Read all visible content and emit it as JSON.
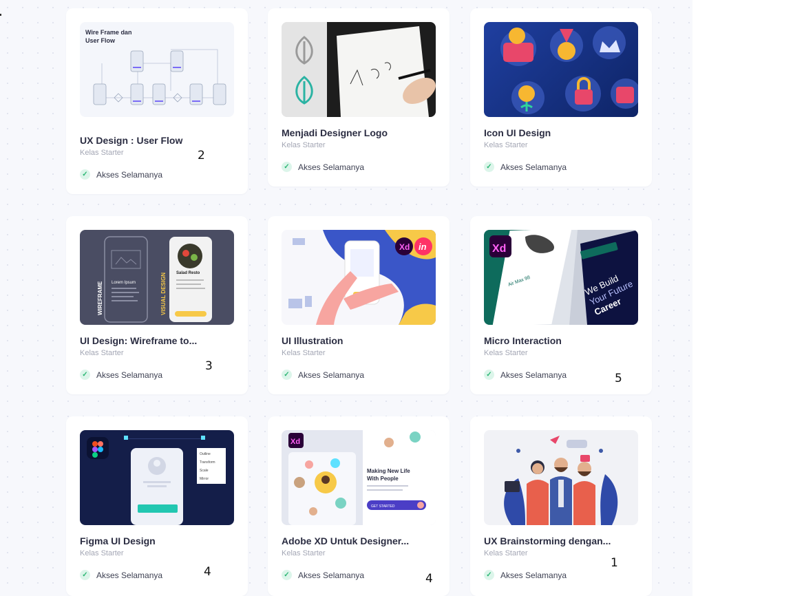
{
  "courses": [
    {
      "title": "UX Design : User Flow",
      "subtitle": "Kelas Starter",
      "access": "Akses Selamanya",
      "thumb_text": [
        "Wire Frame dan",
        "User Flow"
      ]
    },
    {
      "title": "Menjadi Designer Logo",
      "subtitle": "Kelas Starter",
      "access": "Akses Selamanya"
    },
    {
      "title": "Icon UI Design",
      "subtitle": "Kelas Starter",
      "access": "Akses Selamanya"
    },
    {
      "title": "UI Design: Wireframe to...",
      "subtitle": "Kelas Starter",
      "access": "Akses Selamanya",
      "thumb_text": [
        "WIREFRAME",
        "VISUAL DESIGN",
        "Lorem Ipsum",
        "Salad Resto"
      ]
    },
    {
      "title": "UI Illustration",
      "subtitle": "Kelas Starter",
      "access": "Akses Selamanya",
      "thumb_text": [
        "Xd",
        "in"
      ]
    },
    {
      "title": "Micro Interaction",
      "subtitle": "Kelas Starter",
      "access": "Akses Selamanya",
      "thumb_text": [
        "Xd",
        "We Build",
        "Your Future",
        "Career",
        "Air Max 98"
      ]
    },
    {
      "title": "Figma UI Design",
      "subtitle": "Kelas Starter",
      "access": "Akses Selamanya",
      "thumb_text": [
        "Outline",
        "Transform",
        "Scale",
        "Mirror"
      ]
    },
    {
      "title": "Adobe XD Untuk Designer...",
      "subtitle": "Kelas Starter",
      "access": "Akses Selamanya",
      "thumb_text": [
        "Xd",
        "Making New Life",
        "With People",
        "GET STARTED"
      ]
    },
    {
      "title": "UX Brainstorming dengan...",
      "subtitle": "Kelas Starter",
      "access": "Akses Selamanya"
    }
  ],
  "annotations": [
    "2",
    "3",
    "5",
    "4",
    "4",
    "1"
  ],
  "colors": {
    "title": "#2b2d42",
    "subtitle": "#a3a6b4",
    "check_bg": "#dcf5ea",
    "check": "#2bb673"
  },
  "icons": {
    "check": "check-icon"
  }
}
